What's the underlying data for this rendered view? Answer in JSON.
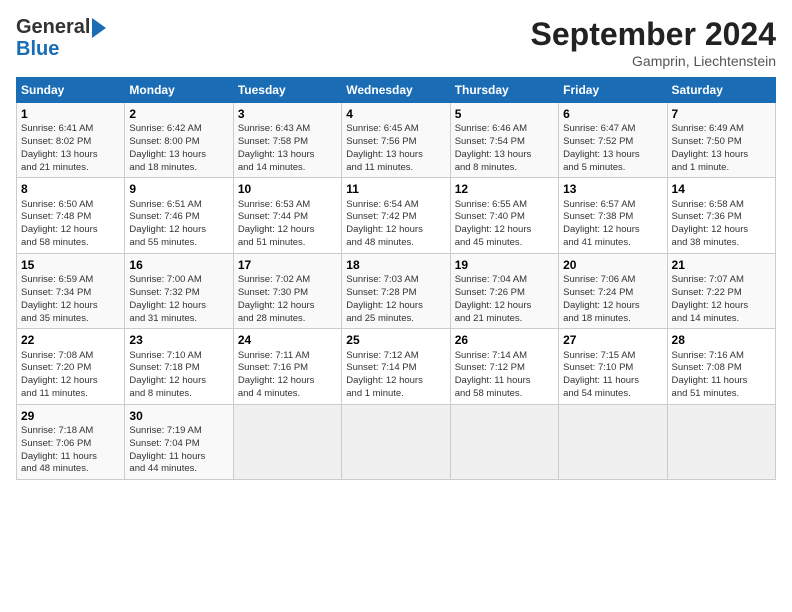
{
  "header": {
    "logo_line1": "General",
    "logo_line2": "Blue",
    "month": "September 2024",
    "location": "Gamprin, Liechtenstein"
  },
  "days_of_week": [
    "Sunday",
    "Monday",
    "Tuesday",
    "Wednesday",
    "Thursday",
    "Friday",
    "Saturday"
  ],
  "weeks": [
    [
      {
        "day": "1",
        "info": "Sunrise: 6:41 AM\nSunset: 8:02 PM\nDaylight: 13 hours\nand 21 minutes."
      },
      {
        "day": "2",
        "info": "Sunrise: 6:42 AM\nSunset: 8:00 PM\nDaylight: 13 hours\nand 18 minutes."
      },
      {
        "day": "3",
        "info": "Sunrise: 6:43 AM\nSunset: 7:58 PM\nDaylight: 13 hours\nand 14 minutes."
      },
      {
        "day": "4",
        "info": "Sunrise: 6:45 AM\nSunset: 7:56 PM\nDaylight: 13 hours\nand 11 minutes."
      },
      {
        "day": "5",
        "info": "Sunrise: 6:46 AM\nSunset: 7:54 PM\nDaylight: 13 hours\nand 8 minutes."
      },
      {
        "day": "6",
        "info": "Sunrise: 6:47 AM\nSunset: 7:52 PM\nDaylight: 13 hours\nand 5 minutes."
      },
      {
        "day": "7",
        "info": "Sunrise: 6:49 AM\nSunset: 7:50 PM\nDaylight: 13 hours\nand 1 minute."
      }
    ],
    [
      {
        "day": "8",
        "info": "Sunrise: 6:50 AM\nSunset: 7:48 PM\nDaylight: 12 hours\nand 58 minutes."
      },
      {
        "day": "9",
        "info": "Sunrise: 6:51 AM\nSunset: 7:46 PM\nDaylight: 12 hours\nand 55 minutes."
      },
      {
        "day": "10",
        "info": "Sunrise: 6:53 AM\nSunset: 7:44 PM\nDaylight: 12 hours\nand 51 minutes."
      },
      {
        "day": "11",
        "info": "Sunrise: 6:54 AM\nSunset: 7:42 PM\nDaylight: 12 hours\nand 48 minutes."
      },
      {
        "day": "12",
        "info": "Sunrise: 6:55 AM\nSunset: 7:40 PM\nDaylight: 12 hours\nand 45 minutes."
      },
      {
        "day": "13",
        "info": "Sunrise: 6:57 AM\nSunset: 7:38 PM\nDaylight: 12 hours\nand 41 minutes."
      },
      {
        "day": "14",
        "info": "Sunrise: 6:58 AM\nSunset: 7:36 PM\nDaylight: 12 hours\nand 38 minutes."
      }
    ],
    [
      {
        "day": "15",
        "info": "Sunrise: 6:59 AM\nSunset: 7:34 PM\nDaylight: 12 hours\nand 35 minutes."
      },
      {
        "day": "16",
        "info": "Sunrise: 7:00 AM\nSunset: 7:32 PM\nDaylight: 12 hours\nand 31 minutes."
      },
      {
        "day": "17",
        "info": "Sunrise: 7:02 AM\nSunset: 7:30 PM\nDaylight: 12 hours\nand 28 minutes."
      },
      {
        "day": "18",
        "info": "Sunrise: 7:03 AM\nSunset: 7:28 PM\nDaylight: 12 hours\nand 25 minutes."
      },
      {
        "day": "19",
        "info": "Sunrise: 7:04 AM\nSunset: 7:26 PM\nDaylight: 12 hours\nand 21 minutes."
      },
      {
        "day": "20",
        "info": "Sunrise: 7:06 AM\nSunset: 7:24 PM\nDaylight: 12 hours\nand 18 minutes."
      },
      {
        "day": "21",
        "info": "Sunrise: 7:07 AM\nSunset: 7:22 PM\nDaylight: 12 hours\nand 14 minutes."
      }
    ],
    [
      {
        "day": "22",
        "info": "Sunrise: 7:08 AM\nSunset: 7:20 PM\nDaylight: 12 hours\nand 11 minutes."
      },
      {
        "day": "23",
        "info": "Sunrise: 7:10 AM\nSunset: 7:18 PM\nDaylight: 12 hours\nand 8 minutes."
      },
      {
        "day": "24",
        "info": "Sunrise: 7:11 AM\nSunset: 7:16 PM\nDaylight: 12 hours\nand 4 minutes."
      },
      {
        "day": "25",
        "info": "Sunrise: 7:12 AM\nSunset: 7:14 PM\nDaylight: 12 hours\nand 1 minute."
      },
      {
        "day": "26",
        "info": "Sunrise: 7:14 AM\nSunset: 7:12 PM\nDaylight: 11 hours\nand 58 minutes."
      },
      {
        "day": "27",
        "info": "Sunrise: 7:15 AM\nSunset: 7:10 PM\nDaylight: 11 hours\nand 54 minutes."
      },
      {
        "day": "28",
        "info": "Sunrise: 7:16 AM\nSunset: 7:08 PM\nDaylight: 11 hours\nand 51 minutes."
      }
    ],
    [
      {
        "day": "29",
        "info": "Sunrise: 7:18 AM\nSunset: 7:06 PM\nDaylight: 11 hours\nand 48 minutes."
      },
      {
        "day": "30",
        "info": "Sunrise: 7:19 AM\nSunset: 7:04 PM\nDaylight: 11 hours\nand 44 minutes."
      },
      {
        "day": "",
        "info": ""
      },
      {
        "day": "",
        "info": ""
      },
      {
        "day": "",
        "info": ""
      },
      {
        "day": "",
        "info": ""
      },
      {
        "day": "",
        "info": ""
      }
    ]
  ]
}
